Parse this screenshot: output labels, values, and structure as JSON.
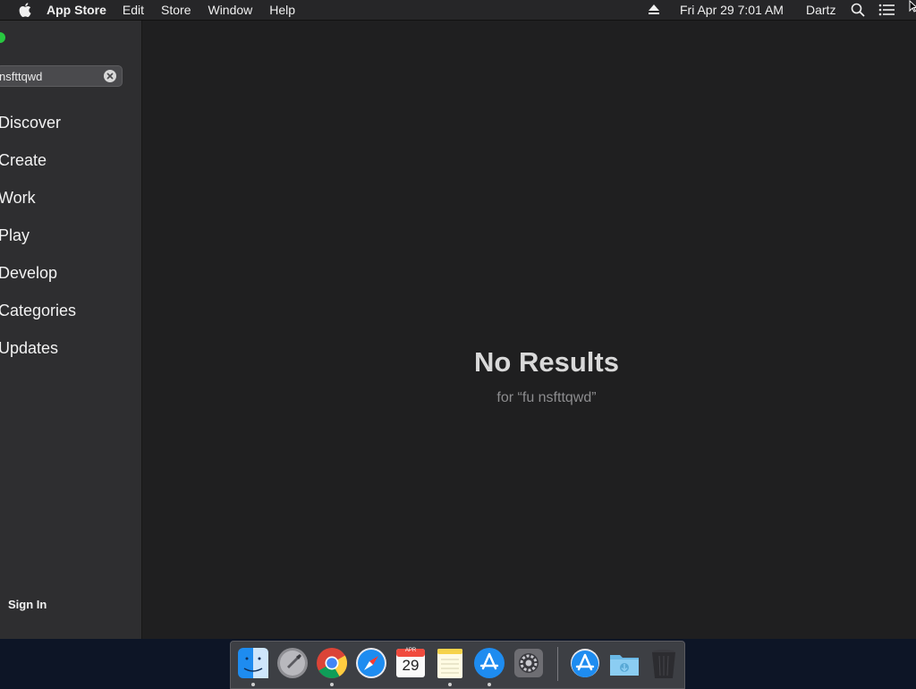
{
  "menubar": {
    "app_name": "App Store",
    "menus": [
      "Edit",
      "Store",
      "Window",
      "Help"
    ],
    "datetime": "Fri Apr 29  7:01 AM",
    "user": "Dartz"
  },
  "sidebar": {
    "search_value": "nsfttqwd",
    "items": [
      {
        "label": "Discover"
      },
      {
        "label": "Create"
      },
      {
        "label": "Work"
      },
      {
        "label": "Play"
      },
      {
        "label": "Develop"
      },
      {
        "label": "Categories"
      },
      {
        "label": "Updates"
      }
    ],
    "sign_in": "Sign In"
  },
  "main": {
    "title": "No Results",
    "subtitle": "for “fu nsfttqwd”"
  },
  "dock": {
    "calendar_month": "APR",
    "calendar_day": "29",
    "apps": [
      "finder-icon",
      "launchpad-icon",
      "chrome-icon",
      "safari-icon",
      "calendar-icon",
      "notes-icon",
      "app-store-icon",
      "system-preferences-icon",
      "app-store-folder-icon",
      "downloads-folder-icon",
      "trash-icon"
    ]
  },
  "colors": {
    "menubar_bg": "#262628",
    "sidebar_bg": "#2e2e30",
    "content_bg": "#1f1f20",
    "accent_blue": "#1e8cf0",
    "traffic_green": "#28c840"
  }
}
